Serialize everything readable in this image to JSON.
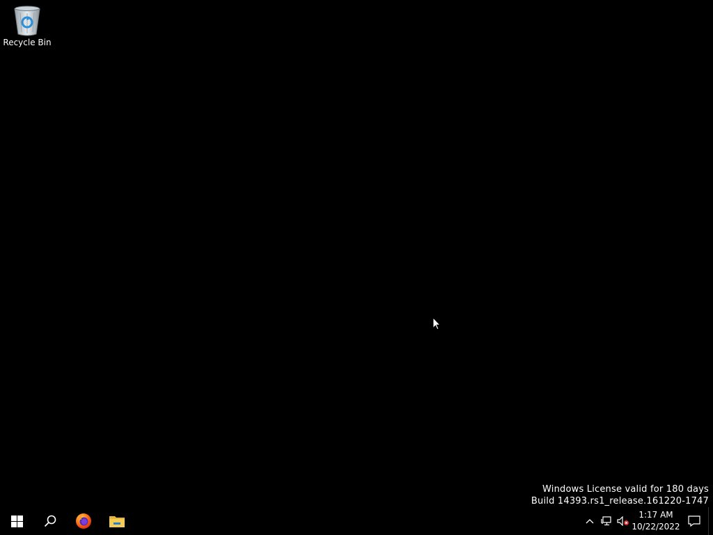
{
  "desktop": {
    "icons": [
      {
        "label": "Recycle Bin",
        "icon": "recycle-bin-icon"
      }
    ],
    "watermark": {
      "line1": "Windows License valid for 180 days",
      "line2": "Build 14393.rs1_release.161220-1747"
    }
  },
  "taskbar": {
    "start": {
      "icon": "windows-start-icon"
    },
    "search": {
      "icon": "search-icon"
    },
    "pinned": [
      {
        "icon": "firefox-icon"
      },
      {
        "icon": "file-explorer-icon"
      }
    ],
    "tray": {
      "icons": [
        "chevron-up-icon",
        "network-icon",
        "volume-muted-icon"
      ],
      "time": "1:17 AM",
      "date": "10/22/2022"
    },
    "action_center": {
      "icon": "notification-icon"
    }
  },
  "colors": {
    "background": "#000000",
    "text": "#ffffff"
  }
}
